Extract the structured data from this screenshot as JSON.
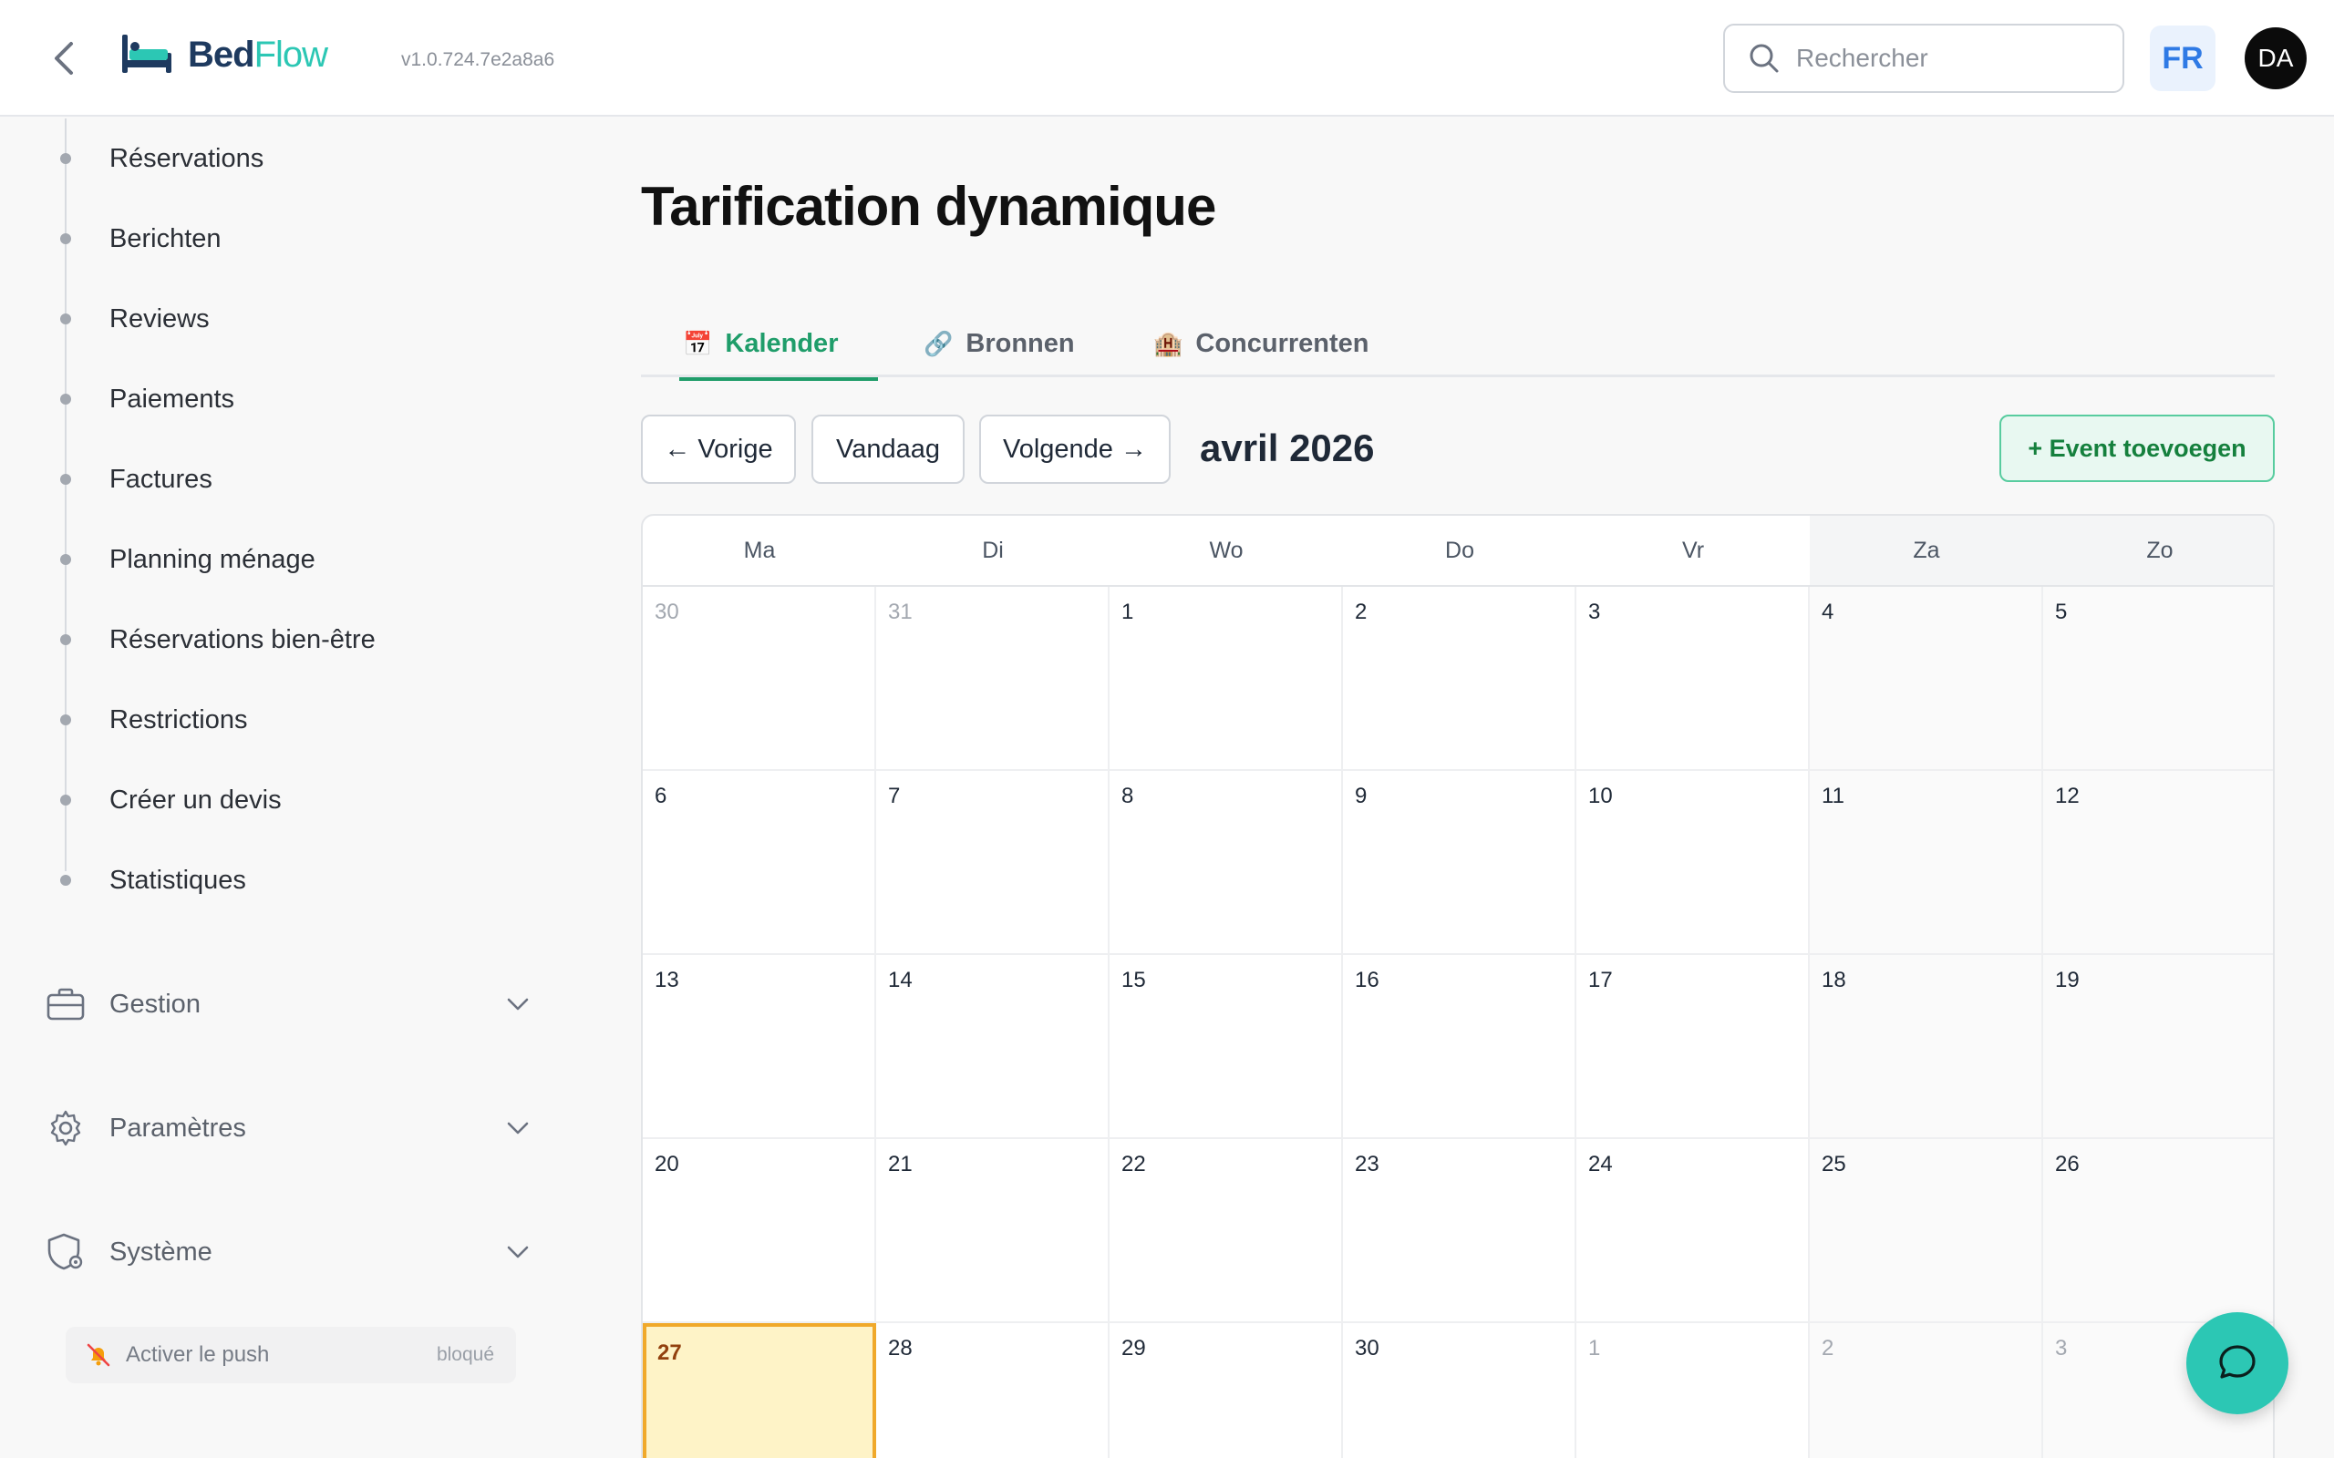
{
  "header": {
    "logo_bed": "Bed",
    "logo_flow": "Flow",
    "version": "v1.0.724.7e2a8a6",
    "search_placeholder": "Rechercher",
    "language": "FR",
    "avatar_initials": "DA"
  },
  "sidebar": {
    "sub_items": [
      {
        "label": "Réservations"
      },
      {
        "label": "Berichten"
      },
      {
        "label": "Reviews"
      },
      {
        "label": "Paiements"
      },
      {
        "label": "Factures"
      },
      {
        "label": "Planning ménage"
      },
      {
        "label": "Réservations bien-être"
      },
      {
        "label": "Restrictions"
      },
      {
        "label": "Créer un devis"
      },
      {
        "label": "Statistiques"
      }
    ],
    "groups": [
      {
        "label": "Gestion",
        "icon": "briefcase-icon"
      },
      {
        "label": "Paramètres",
        "icon": "gear-icon"
      },
      {
        "label": "Système",
        "icon": "shield-gear-icon"
      }
    ],
    "push": {
      "label": "Activer le push",
      "status": "bloqué",
      "icon": "bell-off-icon"
    }
  },
  "main": {
    "title": "Tarification dynamique",
    "tabs": [
      {
        "label": "Kalender",
        "icon": "📅",
        "active": true
      },
      {
        "label": "Bronnen",
        "icon": "🔗",
        "active": false
      },
      {
        "label": "Concurrenten",
        "icon": "🏨",
        "active": false
      }
    ],
    "nav": {
      "prev": "← Vorige",
      "today": "Vandaag",
      "next": "Volgende →"
    },
    "month_label": "avril 2026",
    "add_event": "+ Event toevoegen"
  },
  "calendar": {
    "weekdays": [
      "Ma",
      "Di",
      "Wo",
      "Do",
      "Vr",
      "Za",
      "Zo"
    ],
    "weeks": [
      [
        "30",
        "31",
        "1",
        "2",
        "3",
        "4",
        "5"
      ],
      [
        "6",
        "7",
        "8",
        "9",
        "10",
        "11",
        "12"
      ],
      [
        "13",
        "14",
        "15",
        "16",
        "17",
        "18",
        "19"
      ],
      [
        "20",
        "21",
        "22",
        "23",
        "24",
        "25",
        "26"
      ],
      [
        "27",
        "28",
        "29",
        "30",
        "1",
        "2",
        "3"
      ]
    ],
    "other_month": [
      [
        true,
        true,
        false,
        false,
        false,
        false,
        false
      ],
      [
        false,
        false,
        false,
        false,
        false,
        false,
        false
      ],
      [
        false,
        false,
        false,
        false,
        false,
        false,
        false
      ],
      [
        false,
        false,
        false,
        false,
        false,
        false,
        false
      ],
      [
        false,
        false,
        false,
        false,
        true,
        true,
        true
      ]
    ],
    "today": {
      "week": 4,
      "day": 0
    }
  },
  "colors": {
    "accent_green": "#1f9d6a",
    "brand_teal": "#2cc7b4",
    "today_bg": "#fef3c7",
    "today_border": "#f0a92b"
  }
}
